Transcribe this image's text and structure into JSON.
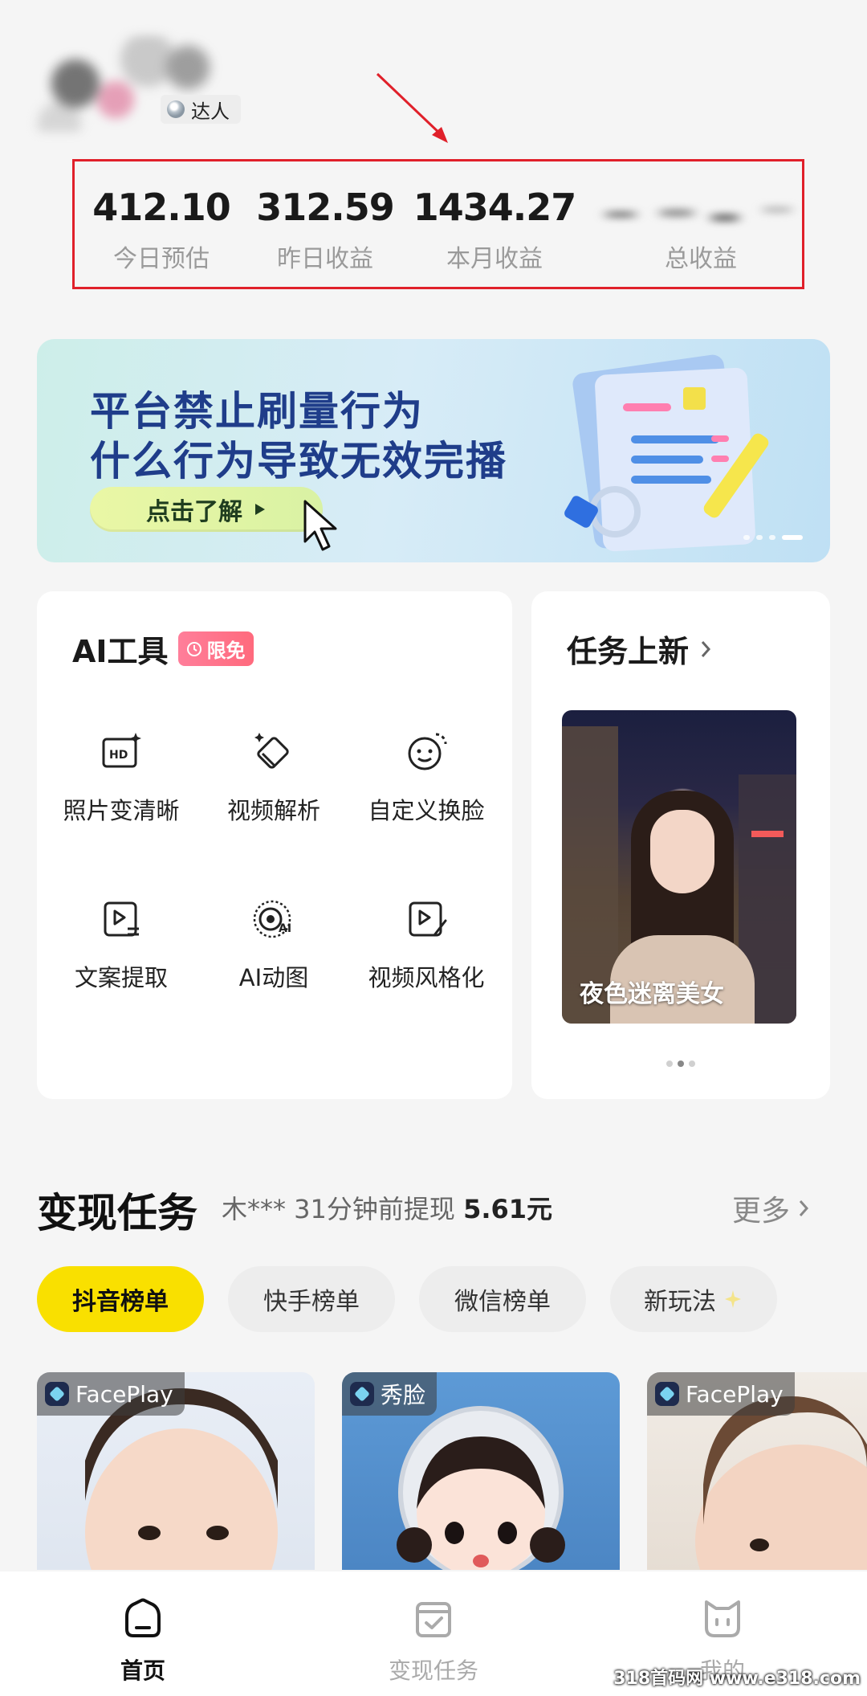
{
  "header": {
    "badge_label": "达人"
  },
  "stats": {
    "today": {
      "value": "412.10",
      "label": "今日预估"
    },
    "yesterday": {
      "value": "312.59",
      "label": "昨日收益"
    },
    "month": {
      "value": "1434.27",
      "label": "本月收益"
    },
    "total": {
      "label": "总收益"
    }
  },
  "banner": {
    "line1": "平台禁止刷量行为",
    "line2": "什么行为导致无效完播",
    "button_label": "点击了解"
  },
  "ai_tools": {
    "title": "AI工具",
    "badge": "限免",
    "items": [
      {
        "label": "照片变清晰",
        "icon": "hd-photo-icon"
      },
      {
        "label": "视频解析",
        "icon": "eraser-icon"
      },
      {
        "label": "自定义换脸",
        "icon": "face-swap-icon"
      },
      {
        "label": "文案提取",
        "icon": "text-extract-icon"
      },
      {
        "label": "AI动图",
        "icon": "ai-animate-icon"
      },
      {
        "label": "视频风格化",
        "icon": "video-style-icon"
      }
    ]
  },
  "new_tasks": {
    "title": "任务上新",
    "card_caption": "夜色迷离美女"
  },
  "monetize": {
    "title": "变现任务",
    "ticker": "木*** 31分钟前提现",
    "ticker_amount": "5.61元",
    "more": "更多",
    "chips": [
      "抖音榜单",
      "快手榜单",
      "微信榜单",
      "新玩法"
    ],
    "videos": [
      {
        "tag": "FacePlay"
      },
      {
        "tag": "秀脸"
      },
      {
        "tag": "FacePlay"
      }
    ]
  },
  "nav": {
    "home": "首页",
    "tasks": "变现任务",
    "mine": "我的"
  },
  "watermark": "318首码网 www.e318.com",
  "colors": {
    "accent_yellow": "#f9e000",
    "highlight_red": "#e0202a",
    "banner_text": "#1f3d8a"
  }
}
